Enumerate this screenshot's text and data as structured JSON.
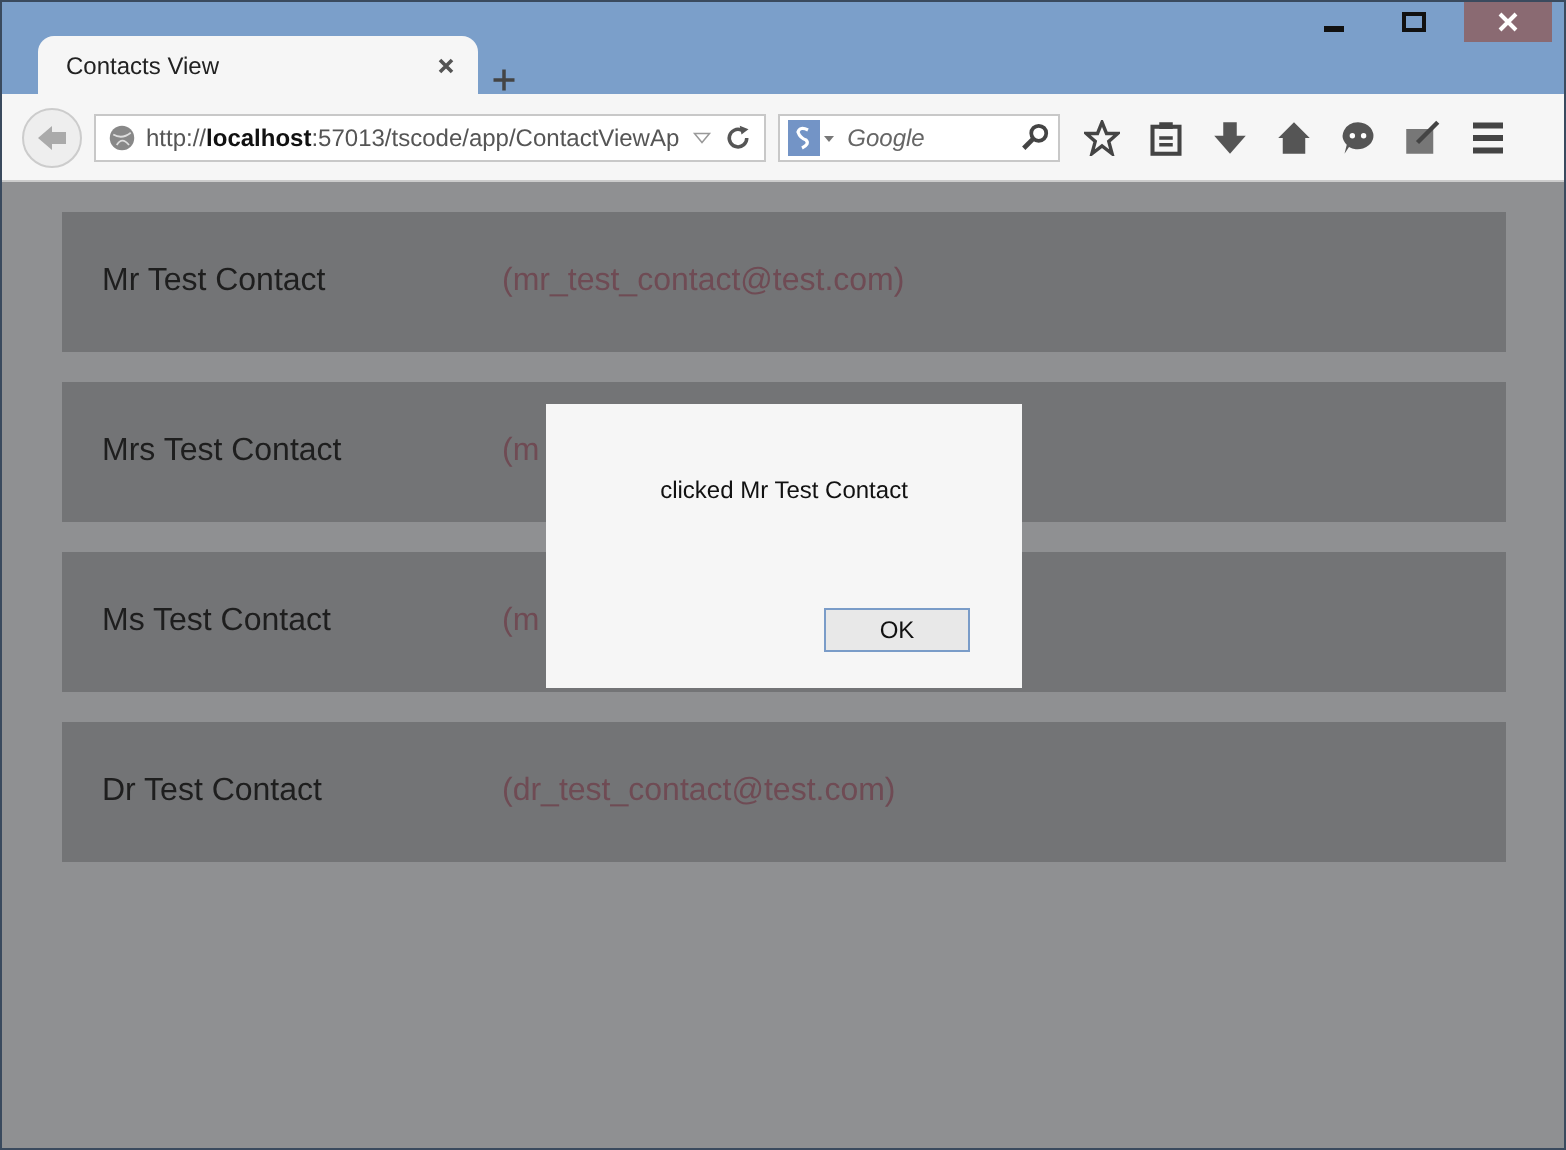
{
  "tabs": [
    {
      "label": "Contacts View",
      "selected": true
    }
  ],
  "address_bar": {
    "value": "http://**localhost**:57013/tscode/app/ContactViewAp"
  },
  "search": {
    "placeholder": "Google"
  },
  "contacts": [
    {
      "name": "Mr Test Contact",
      "email": "(mr_test_contact@test.com)"
    },
    {
      "name": "Mrs Test Contact",
      "email": "(m"
    },
    {
      "name": "Ms Test Contact",
      "email": "(m"
    },
    {
      "name": "Dr Test Contact",
      "email": "(dr_test_contact@test.com)"
    }
  ],
  "dialog": {
    "message": "clicked Mr Test Contact",
    "buttons": [
      "OK"
    ]
  }
}
